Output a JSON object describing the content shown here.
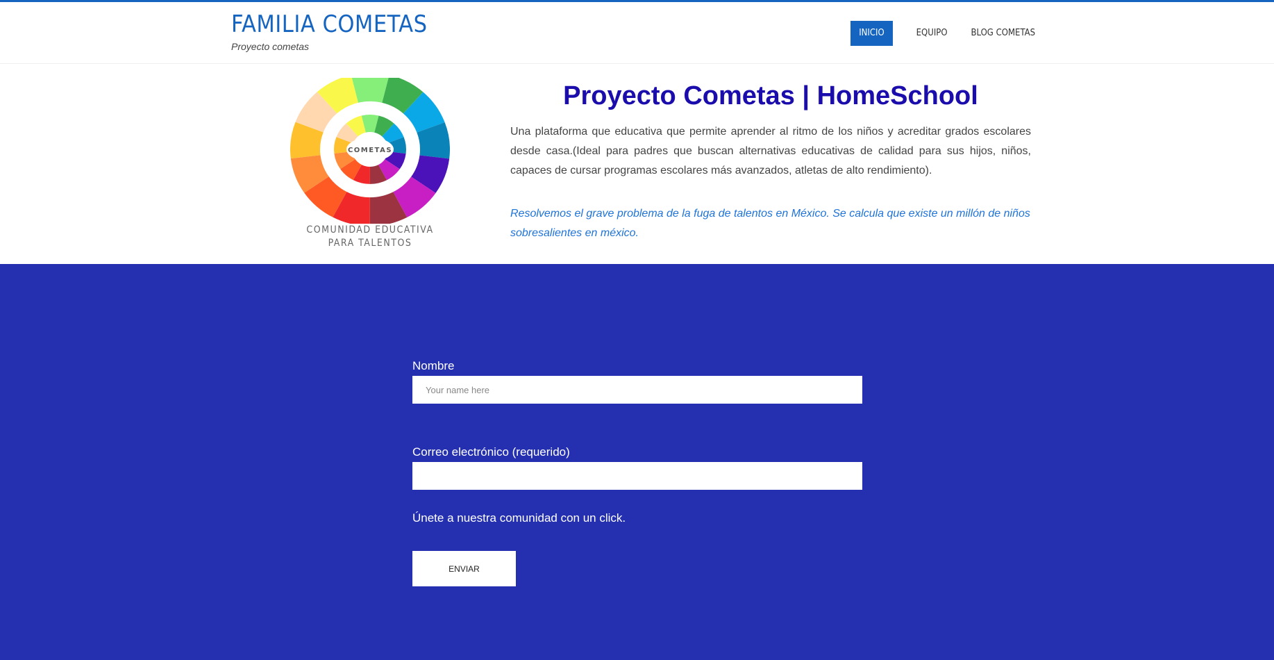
{
  "header": {
    "site_title": "FAMILIA COMETAS",
    "tagline": "Proyecto cometas",
    "nav": [
      {
        "label": "INICIO",
        "active": true
      },
      {
        "label": "EQUIPO",
        "active": false
      },
      {
        "label": "BLOG COMETAS",
        "active": false
      }
    ]
  },
  "hero": {
    "logo_center_text": "COMETAS",
    "logo_caption_line1": "COMUNIDAD EDUCATIVA",
    "logo_caption_line2": "PARA TALENTOS",
    "title": "Proyecto Cometas | HomeSchool",
    "description": "Una plataforma que educativa que permite aprender al ritmo de los niños y acreditar grados escolares desde casa.(Ideal para padres que buscan alternativas educativas de calidad para sus hijos, niños, capaces de cursar programas escolares más avanzados, atletas de alto rendimiento).",
    "quote": "Resolvemos el grave problema de la fuga de talentos en México. Se calcula que existe un millón de niños sobresalientes en méxico."
  },
  "form": {
    "name_label": "Nombre",
    "name_placeholder": "Your name here",
    "email_label": "Correo electrónico (requerido)",
    "join_text": "Únete a nuestra comunidad con un click.",
    "submit_label": "ENVIAR"
  },
  "colors": {
    "brand_blue": "#1565c0",
    "title_blue": "#1a0dab",
    "quote_blue": "#1e73d8",
    "signup_bg": "#2430b0"
  }
}
